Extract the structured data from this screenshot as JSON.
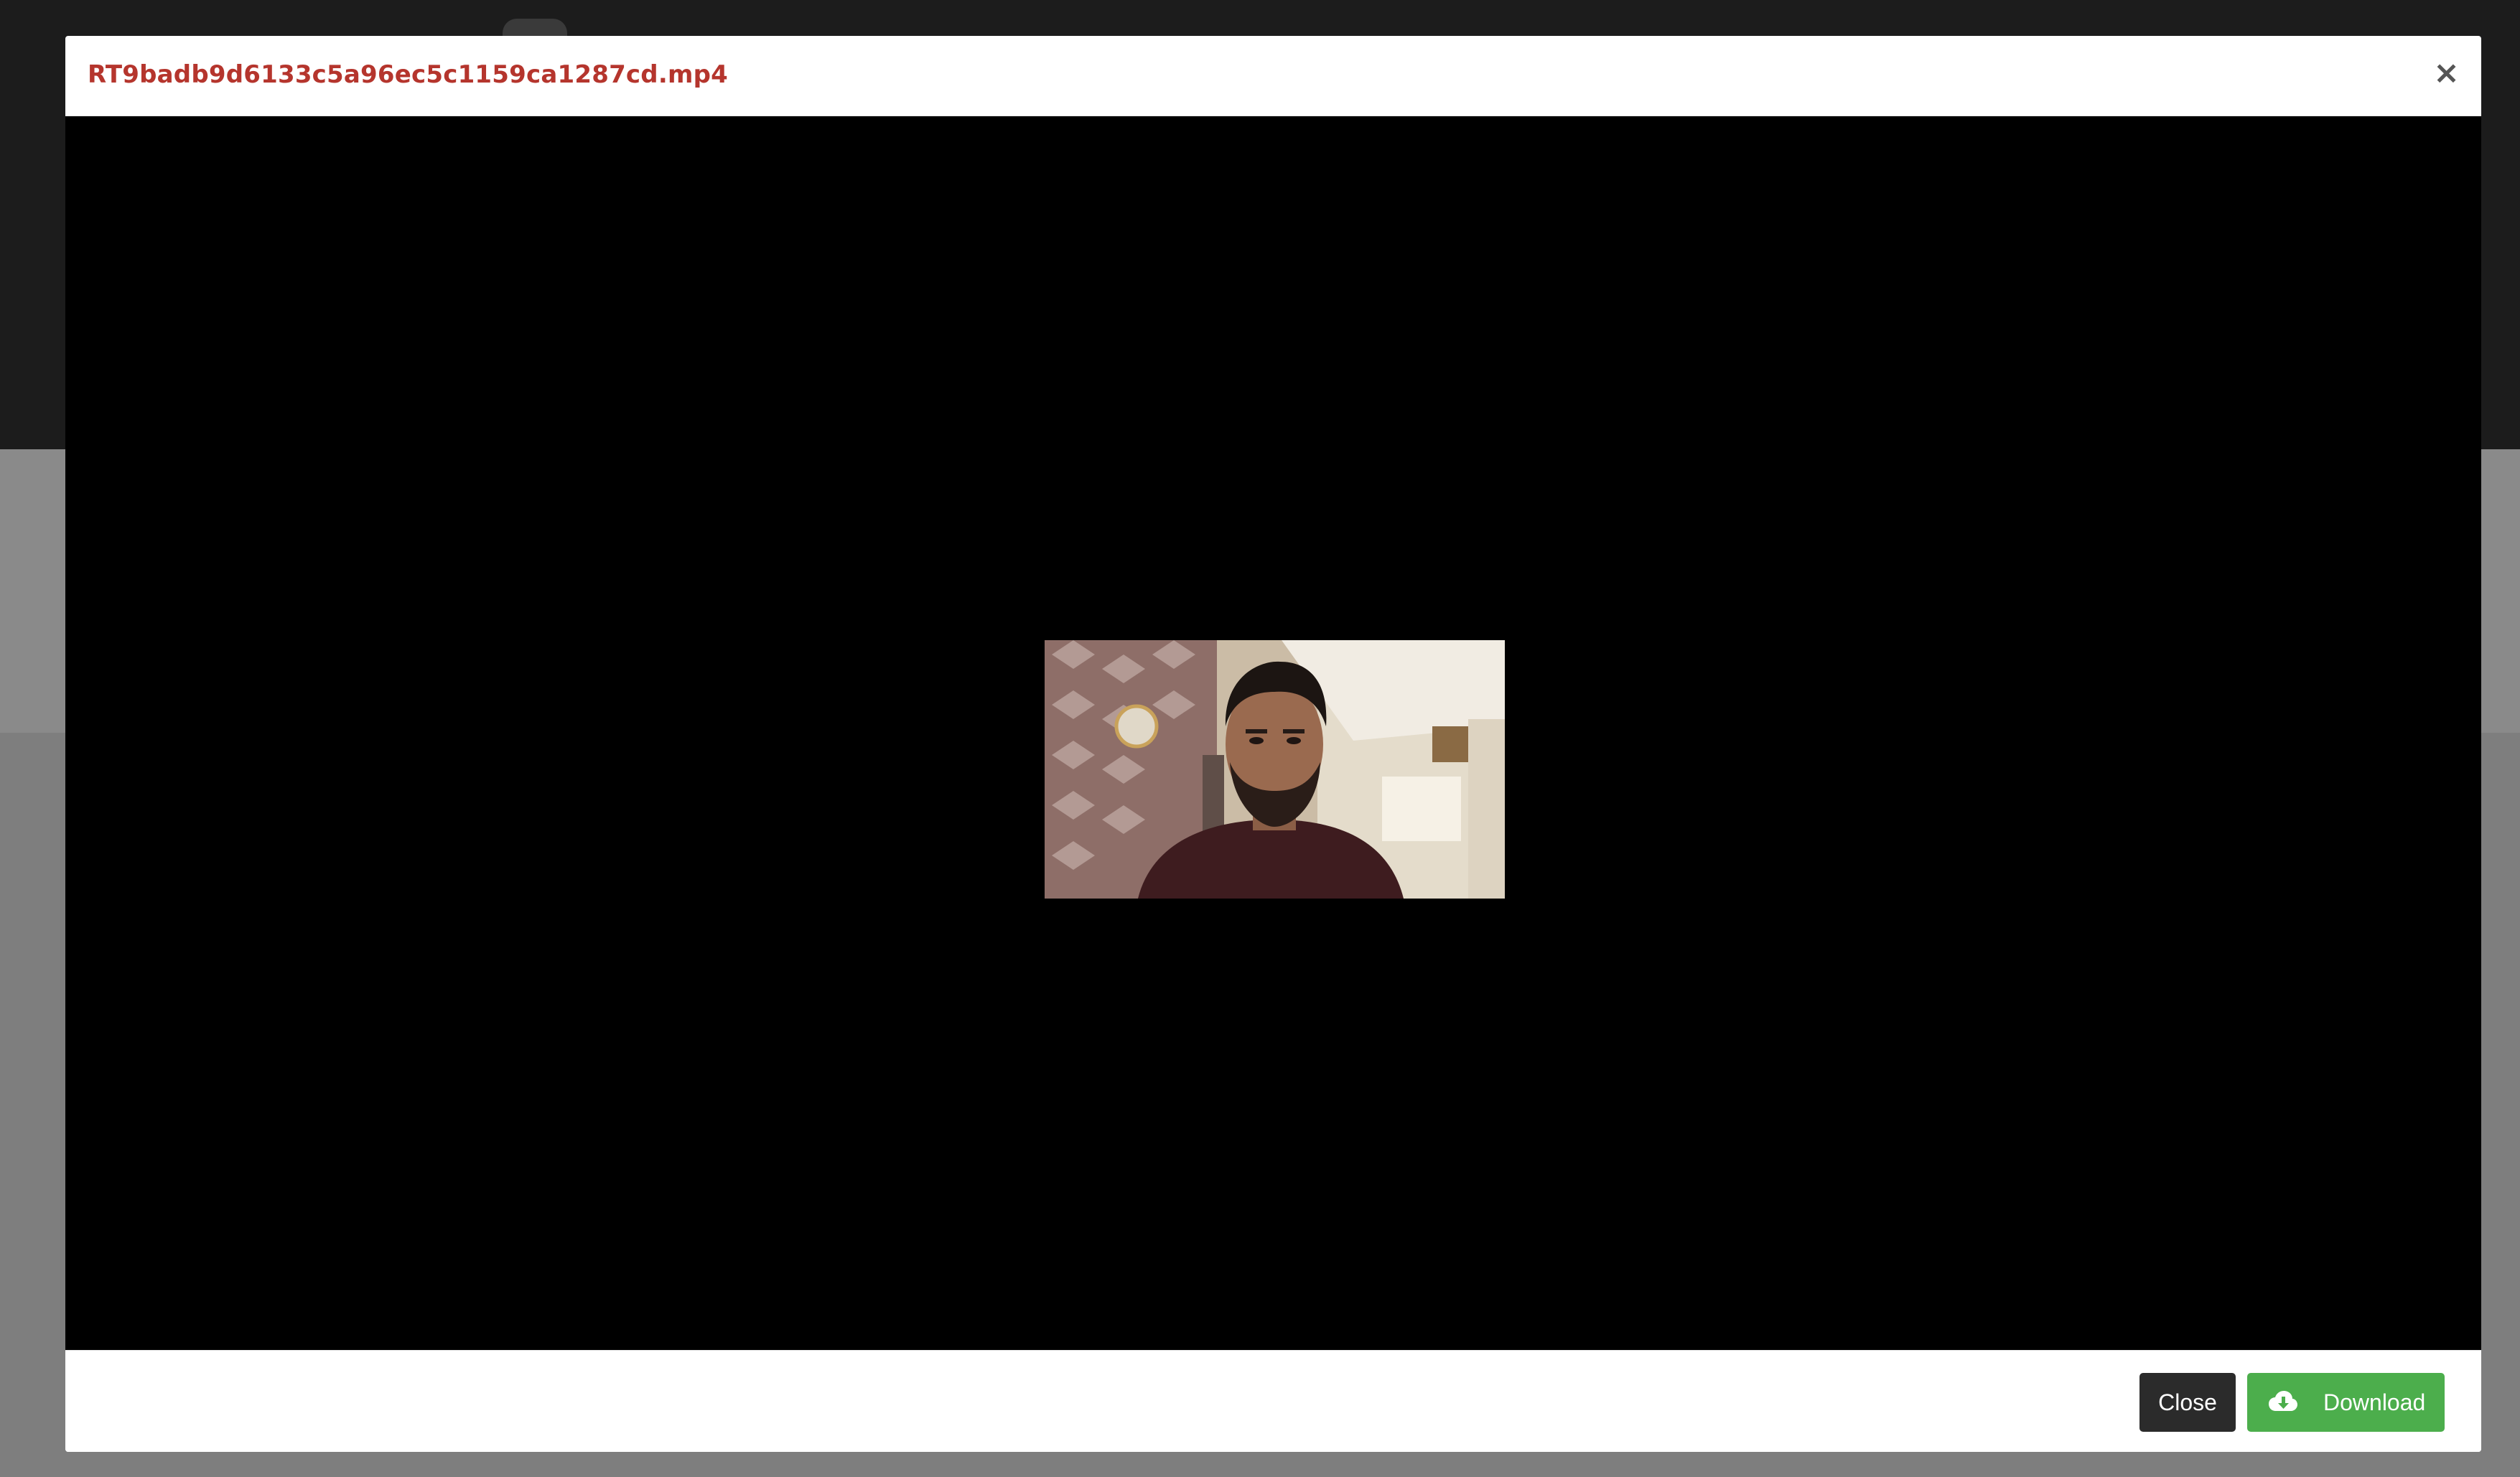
{
  "modal": {
    "title": "RT9badb9d6133c5a96ec5c1159ca1287cd.mp4",
    "close_symbol": "×"
  },
  "footer": {
    "close_label": "Close",
    "download_label": "Download",
    "download_icon": "cloud-download-icon"
  },
  "colors": {
    "title": "#b5352d",
    "download_button": "#4cae4c",
    "close_button": "#2b2b2b",
    "video_background": "#000000"
  }
}
